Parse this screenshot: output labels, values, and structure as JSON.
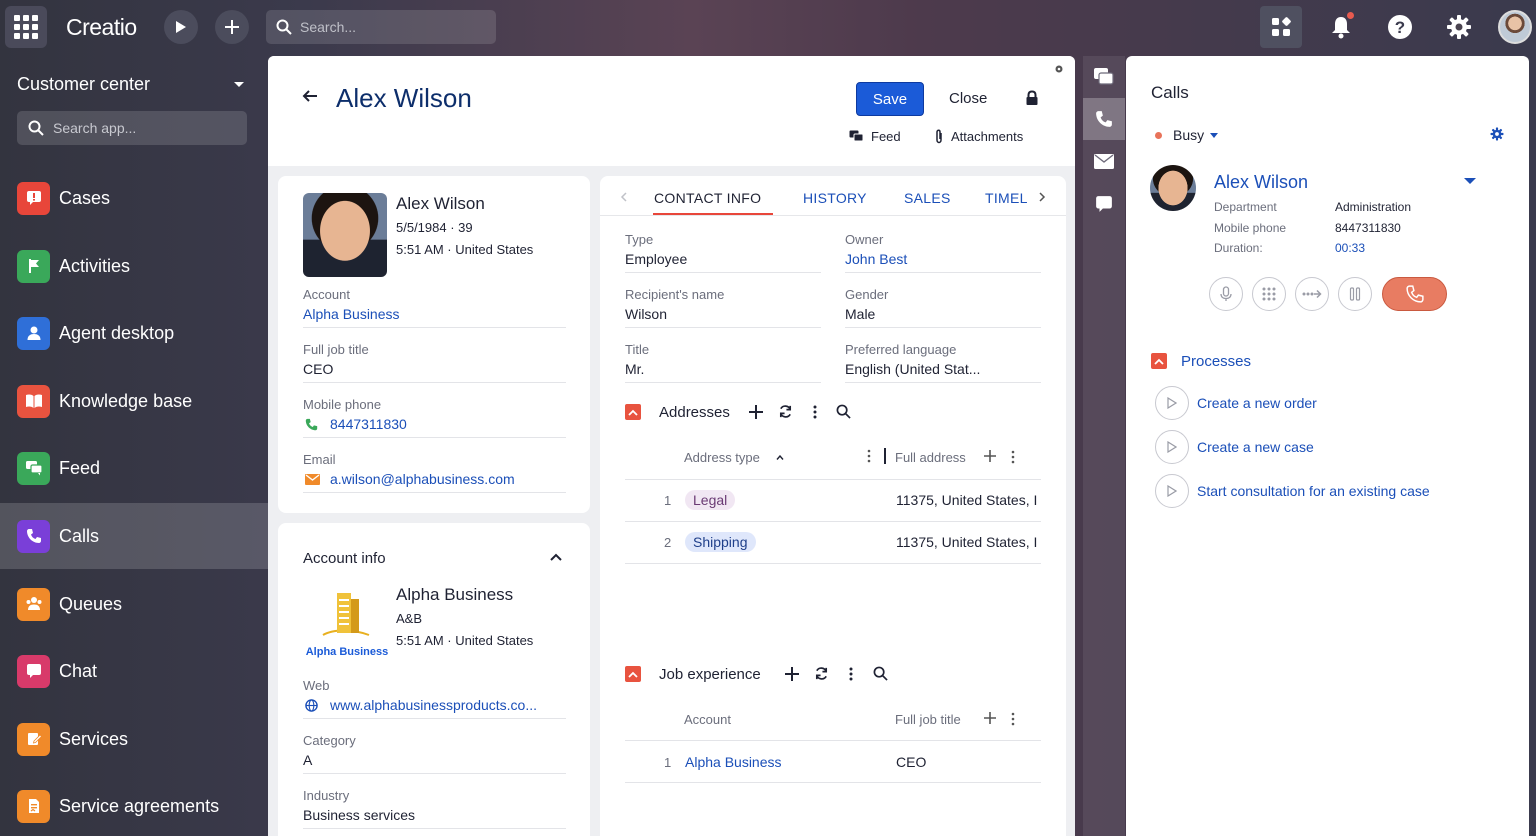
{
  "topbar": {
    "logo": "Creatio",
    "search_placeholder": "Search..."
  },
  "sidebar": {
    "workplace": "Customer center",
    "search_placeholder": "Search app...",
    "items": [
      {
        "label": "Cases",
        "color": "#e8463a",
        "icon": "cases-icon"
      },
      {
        "label": "Activities",
        "color": "#3aa85a",
        "icon": "flag-icon"
      },
      {
        "label": "Agent desktop",
        "color": "#2f6fd8",
        "icon": "agent-icon"
      },
      {
        "label": "Knowledge base",
        "color": "#e8533f",
        "icon": "book-icon"
      },
      {
        "label": "Feed",
        "color": "#3aa85a",
        "icon": "feed-icon"
      },
      {
        "label": "Calls",
        "color": "#7a3fd8",
        "icon": "phone-icon"
      },
      {
        "label": "Queues",
        "color": "#f08a2a",
        "icon": "queues-icon"
      },
      {
        "label": "Chat",
        "color": "#d83a6a",
        "icon": "chat-icon"
      },
      {
        "label": "Services",
        "color": "#f08a2a",
        "icon": "services-icon"
      },
      {
        "label": "Service agreements",
        "color": "#f08a2a",
        "icon": "agreements-icon"
      }
    ]
  },
  "record": {
    "title": "Alex Wilson",
    "save_label": "Save",
    "close_label": "Close",
    "feed_label": "Feed",
    "attachments_label": "Attachments"
  },
  "profile": {
    "name": "Alex Wilson",
    "birth": "5/5/1984 · 39",
    "time_location": "5:51 AM · United States",
    "account_label": "Account",
    "account_value": "Alpha Business",
    "job_label": "Full job title",
    "job_value": "CEO",
    "mobile_label": "Mobile phone",
    "mobile_value": "8447311830",
    "email_label": "Email",
    "email_value": "a.wilson@alphabusiness.com"
  },
  "account_info": {
    "title": "Account info",
    "name": "Alpha Business",
    "code": "A&B",
    "time_location": "5:51 AM · United States",
    "logo_text": "Alpha Business",
    "web_label": "Web",
    "web_value": "www.alphabusinessproducts.co...",
    "category_label": "Category",
    "category_value": "A",
    "industry_label": "Industry",
    "industry_value": "Business services"
  },
  "tabs": [
    "CONTACT INFO",
    "HISTORY",
    "SALES",
    "TIMEL"
  ],
  "contact_info": {
    "type_label": "Type",
    "type_value": "Employee",
    "owner_label": "Owner",
    "owner_value": "John Best",
    "recipient_label": "Recipient's name",
    "recipient_value": "Wilson",
    "gender_label": "Gender",
    "gender_value": "Male",
    "title_label": "Title",
    "title_value": "Mr.",
    "language_label": "Preferred language",
    "language_value": "English (United Stat..."
  },
  "addresses": {
    "title": "Addresses",
    "col_type": "Address type",
    "col_full": "Full address",
    "rows": [
      {
        "num": "1",
        "type": "Legal",
        "address": "11375, United States, I"
      },
      {
        "num": "2",
        "type": "Shipping",
        "address": "11375, United States, I"
      }
    ]
  },
  "job_experience": {
    "title": "Job experience",
    "col_account": "Account",
    "col_job": "Full job title",
    "rows": [
      {
        "num": "1",
        "account": "Alpha Business",
        "job": "CEO"
      }
    ]
  },
  "calls_panel": {
    "title": "Calls",
    "status": "Busy",
    "caller_name": "Alex Wilson",
    "department_label": "Department",
    "department_value": "Administration",
    "mobile_label": "Mobile phone",
    "mobile_value": "8447311830",
    "duration_label": "Duration:",
    "duration_value": "00:33",
    "processes_title": "Processes",
    "processes": [
      "Create a new order",
      "Create a new case",
      "Start consultation for an existing case"
    ]
  }
}
